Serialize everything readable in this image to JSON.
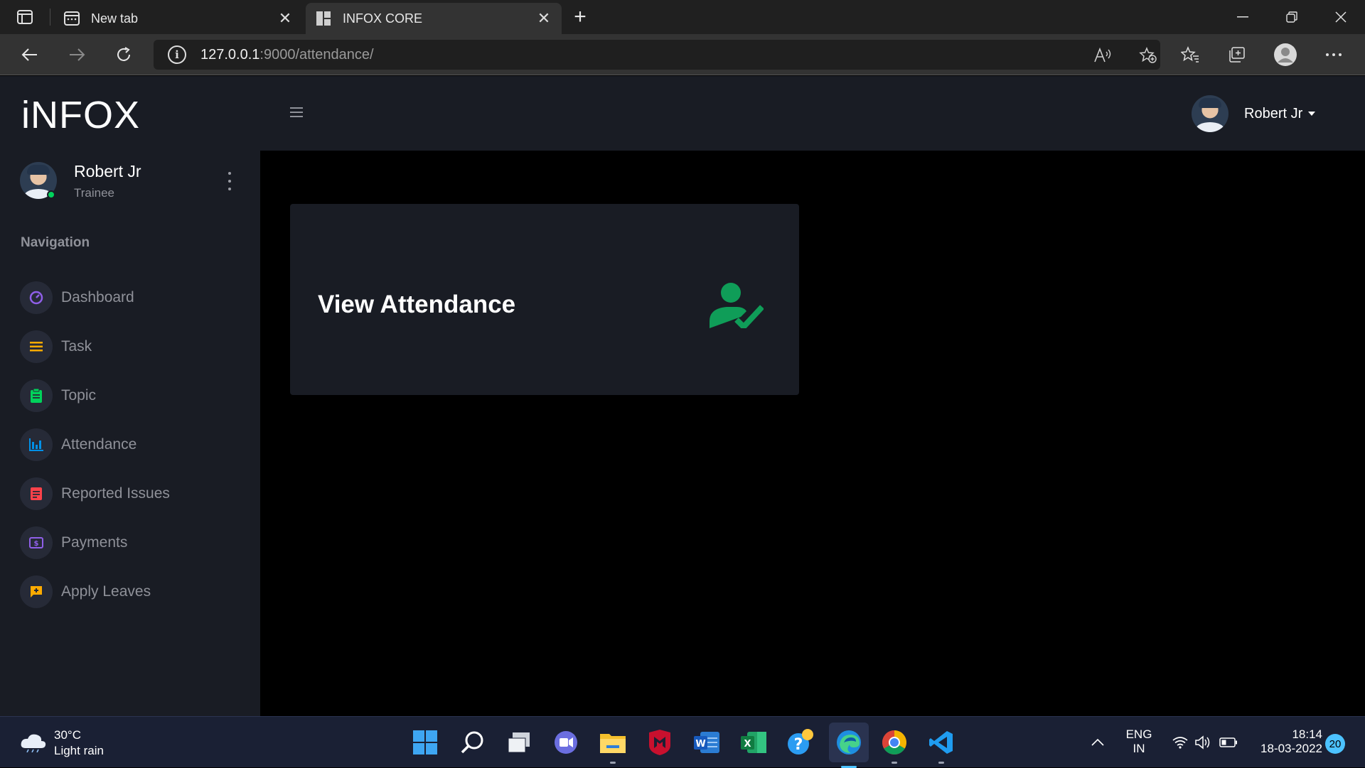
{
  "browser": {
    "tabs": [
      {
        "title": "New tab",
        "active": false
      },
      {
        "title": "INFOX CORE",
        "active": true
      }
    ],
    "url_host": "127.0.0.1",
    "url_rest": ":9000/attendance/"
  },
  "sidebar": {
    "brand": "iNFOX",
    "user_name": "Robert Jr",
    "user_role": "Trainee",
    "nav_header": "Navigation",
    "items": [
      {
        "label": "Dashboard",
        "icon": "speedometer-icon",
        "color": "#8f5fe8"
      },
      {
        "label": "Task",
        "icon": "list-icon",
        "color": "#ffab00"
      },
      {
        "label": "Topic",
        "icon": "clipboard-icon",
        "color": "#00d25b"
      },
      {
        "label": "Attendance",
        "icon": "bar-chart-icon",
        "color": "#0090e7"
      },
      {
        "label": "Reported Issues",
        "icon": "note-icon",
        "color": "#fc424a"
      },
      {
        "label": "Payments",
        "icon": "money-icon",
        "color": "#8f5fe8"
      },
      {
        "label": "Apply Leaves",
        "icon": "message-plus-icon",
        "color": "#ffab00"
      }
    ]
  },
  "topbar": {
    "user_name": "Robert Jr"
  },
  "main": {
    "card_title": "View Attendance",
    "card_icon": "user-check-icon",
    "card_icon_color": "#0f9d58"
  },
  "taskbar": {
    "weather_temp": "30°C",
    "weather_desc": "Light rain",
    "lang_1": "ENG",
    "lang_2": "IN",
    "time": "18:14",
    "date": "18-03-2022",
    "notifications": "20"
  }
}
